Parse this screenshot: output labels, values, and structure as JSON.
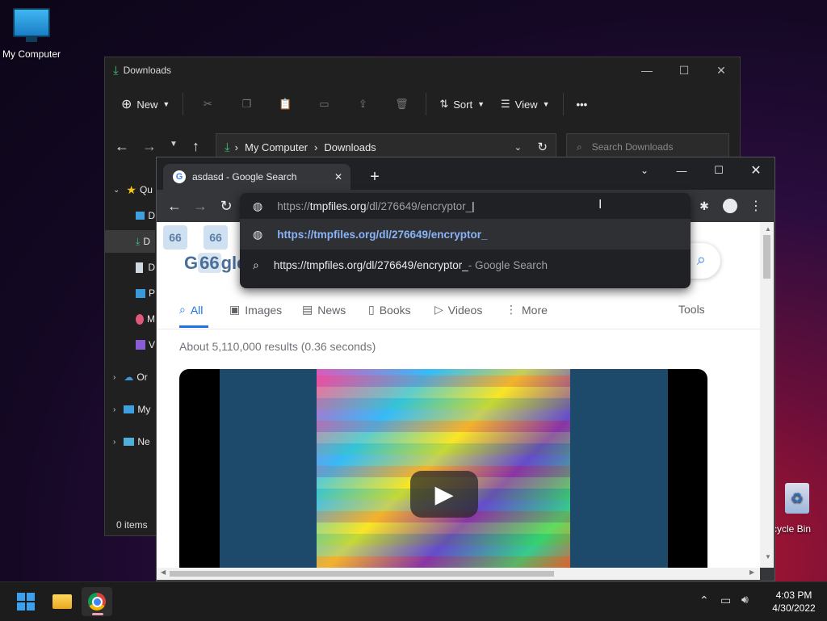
{
  "desktop": {
    "my_computer_label": "My Computer",
    "recycle_bin_label": "cycle Bin"
  },
  "explorer": {
    "title": "Downloads",
    "toolbar": {
      "new_label": "New",
      "sort_label": "Sort",
      "view_label": "View",
      "more_label": "•••"
    },
    "breadcrumb": [
      "My Computer",
      "Downloads"
    ],
    "search_placeholder": "Search Downloads",
    "nav_items": [
      {
        "label": "Qu",
        "icon": "star-icon"
      },
      {
        "label": "D",
        "icon": "desktop-icon"
      },
      {
        "label": "D",
        "icon": "download-icon"
      },
      {
        "label": "D",
        "icon": "document-icon"
      },
      {
        "label": "P",
        "icon": "pictures-icon"
      },
      {
        "label": "M",
        "icon": "music-icon"
      },
      {
        "label": "V",
        "icon": "videos-icon"
      },
      {
        "label": "Or",
        "icon": "cloud-icon"
      },
      {
        "label": "My",
        "icon": "computer-icon"
      },
      {
        "label": "Ne",
        "icon": "network-icon"
      }
    ],
    "status": "0 items"
  },
  "chrome": {
    "tab_title": "asdasd - Google Search",
    "omnibox_value": "https://tmpfiles.org/dl/276649/encryptor_",
    "omnibox_host": "tmpfiles.org",
    "omnibox_prefix": "https://",
    "omnibox_path": "/dl/276649/encryptor_",
    "suggestions": [
      {
        "text": "https://tmpfiles.org/dl/276649/encryptor_",
        "suffix": "",
        "icon": "globe-icon"
      },
      {
        "text": "https://tmpfiles.org/dl/276649/encryptor_",
        "suffix": " - Google Search",
        "icon": "search-icon"
      }
    ],
    "google_tabs": [
      {
        "label": "All",
        "icon": "search-icon"
      },
      {
        "label": "Images",
        "icon": "image-icon"
      },
      {
        "label": "News",
        "icon": "news-icon"
      },
      {
        "label": "Books",
        "icon": "book-icon"
      },
      {
        "label": "Videos",
        "icon": "video-icon"
      },
      {
        "label": "More",
        "icon": "more-vert-icon"
      }
    ],
    "tools_label": "Tools",
    "result_stats": "About 5,110,000 results (0.36 seconds)",
    "colors": {
      "accent": "#1a73e8",
      "link": "#8ab4f8"
    }
  },
  "taskbar": {
    "time": "4:03 PM",
    "date": "4/30/2022"
  }
}
